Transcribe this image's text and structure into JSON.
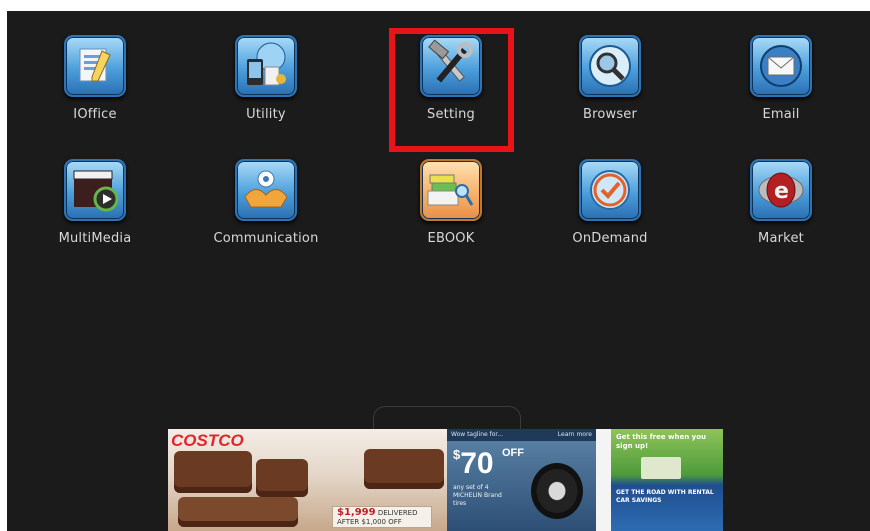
{
  "apps": [
    {
      "label": "IOffice",
      "icon": "ioffice-icon",
      "key": "ioffice"
    },
    {
      "label": "Utility",
      "icon": "utility-icon",
      "key": "utility"
    },
    {
      "label": "Setting",
      "icon": "setting-icon",
      "key": "setting"
    },
    {
      "label": "Browser",
      "icon": "browser-icon",
      "key": "browser"
    },
    {
      "label": "Email",
      "icon": "email-icon",
      "key": "email"
    },
    {
      "label": "MultiMedia",
      "icon": "multimedia-icon",
      "key": "multimedia"
    },
    {
      "label": "Communication",
      "icon": "communication-icon",
      "key": "communication"
    },
    {
      "label": "EBOOK",
      "icon": "ebook-icon",
      "key": "ebook"
    },
    {
      "label": "OnDemand",
      "icon": "ondemand-icon",
      "key": "ondemand"
    },
    {
      "label": "Market",
      "icon": "market-icon",
      "key": "market"
    }
  ],
  "highlight": {
    "target": "Setting",
    "color": "#e8141a"
  },
  "ad": {
    "costco_logo": "COSTCO",
    "costco_price": "$1,999",
    "costco_price_note": "DELIVERED",
    "costco_after": "AFTER $1,000 OFF",
    "tire_header": "Wow tagline for...",
    "tire_link": "Learn more",
    "tire_price": "70",
    "tire_off": "OFF",
    "tire_note": "any set of 4 MICHELIN Brand tires",
    "green_text": "Get this free when you sign up!",
    "blue_text": "GET THE ROAD WITH RENTAL CAR SAVINGS"
  },
  "colors": {
    "background": "#1b1b1b",
    "label": "#d8d8d8",
    "icon_blue": "#4d9fdc",
    "icon_orange": "#f7b269"
  }
}
